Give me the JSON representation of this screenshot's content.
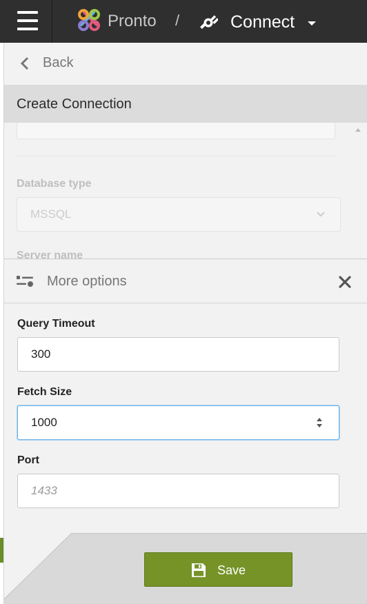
{
  "topbar": {
    "app_name": "Pronto",
    "separator": "/",
    "current_section": "Connect",
    "background": "#2f2f2f"
  },
  "nav": {
    "back_label": "Back"
  },
  "page": {
    "title": "Create Connection"
  },
  "background_form": {
    "database_type_label": "Database type",
    "database_type_value": "MSSQL",
    "server_name_label": "Server name"
  },
  "more_options": {
    "title": "More options",
    "fields": {
      "query_timeout": {
        "label": "Query Timeout",
        "value": "300"
      },
      "fetch_size": {
        "label": "Fetch Size",
        "value": "1000"
      },
      "port": {
        "label": "Port",
        "value": "",
        "placeholder": "1433"
      }
    }
  },
  "footer": {
    "save_label": "Save",
    "save_color": "#769328"
  },
  "icons": {
    "menu": "hamburger-icon",
    "logo": "pronto-logo",
    "section": "plug-icon",
    "dropdown": "caret-down-icon",
    "back": "chevron-left-icon",
    "options": "sliders-icon",
    "close": "close-icon",
    "save": "floppy-disk-icon"
  }
}
